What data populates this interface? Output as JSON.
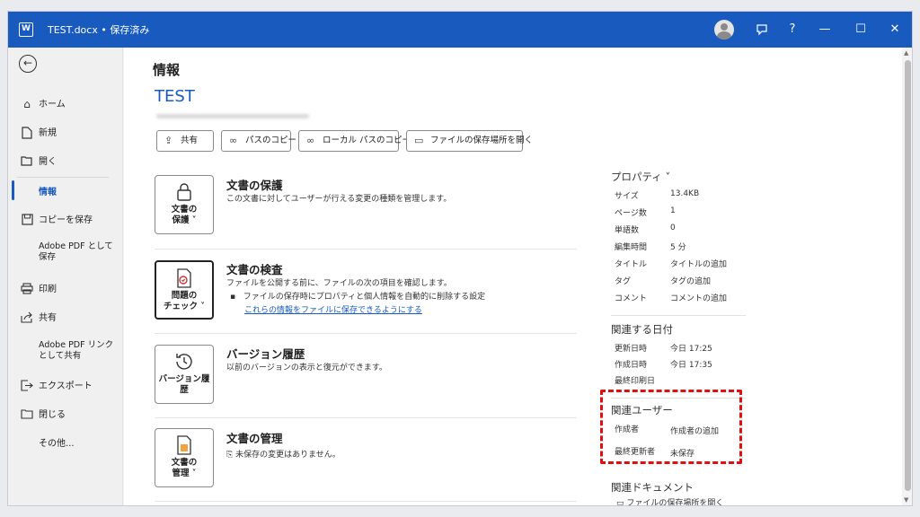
{
  "titlebar": {
    "app_logo": "W",
    "doc_title": "TEST.docx • 保存済み",
    "icons": [
      "user-avatar-icon",
      "feedback-icon",
      "help-icon",
      "minimize-icon",
      "maximize-icon",
      "close-icon"
    ],
    "help_glyph": "?",
    "minimize_glyph": "—",
    "maximize_glyph": "☐",
    "close_glyph": "✕"
  },
  "sidebar": {
    "back_glyph": "←",
    "items": [
      {
        "label": "ホーム",
        "icon": "home-icon"
      },
      {
        "label": "新規",
        "icon": "new-document-icon"
      },
      {
        "label": "開く",
        "icon": "open-folder-icon"
      },
      {
        "label": "情報",
        "icon": "",
        "active": true
      },
      {
        "label": "コピーを保存",
        "icon": "save-copy-icon"
      },
      {
        "label": "Adobe PDF として保存",
        "icon": ""
      },
      {
        "label": "印刷",
        "icon": "print-icon"
      },
      {
        "label": "共有",
        "icon": "share-icon"
      },
      {
        "label": "Adobe PDF リンクとして共有",
        "icon": ""
      },
      {
        "label": "エクスポート",
        "icon": "export-icon"
      },
      {
        "label": "閉じる",
        "icon": "close-folder-icon"
      },
      {
        "label": "その他...",
        "icon": ""
      }
    ]
  },
  "main": {
    "page_title": "情報",
    "doc_name": "TEST",
    "actions": [
      {
        "label": "共有",
        "icon": "share-icon"
      },
      {
        "label": "パスのコピー",
        "icon": "link-icon"
      },
      {
        "label": "ローカル パスのコピー",
        "icon": "link-icon"
      },
      {
        "label": "ファイルの保存場所を開く",
        "icon": "folder-icon"
      }
    ],
    "sections": [
      {
        "button": "文書の\n保護 ˅",
        "title": "文書の保護",
        "desc": "この文書に対してユーザーが行える変更の種類を管理します。",
        "icon": "lock-icon"
      },
      {
        "button": "問題の\nチェック ˅",
        "title": "文書の検査",
        "desc": "ファイルを公開する前に、ファイルの次の項目を確認します。",
        "bullet": "ファイルの保存時にプロパティと個人情報を自動的に削除する設定",
        "link": "これらの情報をファイルに保存できるようにする",
        "icon": "inspect-icon"
      },
      {
        "button": "バージョン履\n歴",
        "title": "バージョン履歴",
        "desc": "以前のバージョンの表示と復元ができます。",
        "icon": "history-icon"
      },
      {
        "button": "文書の\n管理 ˅",
        "title": "文書の管理",
        "desc": "未保存の変更はありません。",
        "icon": "manage-document-icon"
      }
    ]
  },
  "properties": {
    "header": "プロパティ ˅",
    "rows": [
      {
        "k": "サイズ",
        "v": "13.4KB"
      },
      {
        "k": "ページ数",
        "v": "1"
      },
      {
        "k": "単語数",
        "v": "0"
      },
      {
        "k": "編集時間",
        "v": "5 分"
      },
      {
        "k": "タイトル",
        "v": "タイトルの追加"
      },
      {
        "k": "タグ",
        "v": "タグの追加"
      },
      {
        "k": "コメント",
        "v": "コメントの追加"
      }
    ],
    "dates_header": "関連する日付",
    "dates": [
      {
        "k": "更新日時",
        "v": "今日 17:25"
      },
      {
        "k": "作成日時",
        "v": "今日 17:35"
      },
      {
        "k": "最終印刷日",
        "v": ""
      }
    ],
    "users_header": "関連ユーザー",
    "users": [
      {
        "k": "作成者",
        "v": "作成者の追加"
      },
      {
        "k": "最終更新者",
        "v": "未保存"
      }
    ],
    "docs_header": "関連ドキュメント",
    "docs_link": "ファイルの保存場所を開く"
  },
  "colors": {
    "titlebar": "#185abd",
    "highlight": "#e01010"
  }
}
